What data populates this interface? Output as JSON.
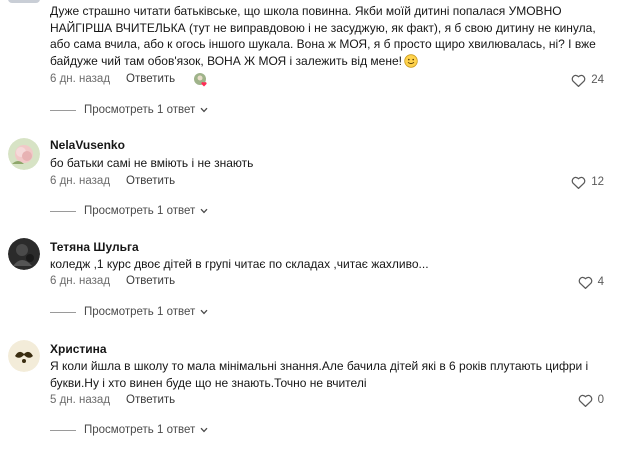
{
  "comments": [
    {
      "author": "",
      "text": "Дуже страшно читати батьківське, що школа повинна. Якби моїй дитині попалася УМОВНО НАЙГІРША ВЧИТЕЛЬКА (тут не виправдовою і не засуджую, як факт), я б свою дитину не кинула, або сама вчила, або к огось іншого шукала. Вона ж МОЯ, я б просто щиро хвилювалась, ні? І вже байдуже чий там обов'язок, ВОНА Ж МОЯ і залежить від мене!",
      "text_emoji": "smiling-face-icon",
      "time": "6 дн. назад",
      "reply_label": "Ответить",
      "likes": "24",
      "replies_label": "Просмотреть 1 ответ"
    },
    {
      "author": "NelaVusenko",
      "text": "бо батьки самі не вміють і не знають",
      "time": "6 дн. назад",
      "reply_label": "Ответить",
      "likes": "12",
      "replies_label": "Просмотреть 1 ответ"
    },
    {
      "author": "Тетяна Шульга",
      "text": "коледж ,1 курс двоє дітей в групі читає по складах ,читає жахливо...",
      "time": "6 дн. назад",
      "reply_label": "Ответить",
      "likes": "4",
      "replies_label": "Просмотреть 1 ответ"
    },
    {
      "author": "Христина",
      "text": "Я коли йшла в школу то мала мінімальні знання.Але бачила дітей які в 6 років плутають цифри і букви.Ну і хто винен буде що не знають.Точно не вчителі",
      "time": "5 дн. назад",
      "reply_label": "Ответить",
      "likes": "0",
      "replies_label": "Просмотреть 1 ответ"
    }
  ],
  "colors": {
    "text": "#161616",
    "muted": "#6b6b6b",
    "divider": "#9a9a9a"
  }
}
